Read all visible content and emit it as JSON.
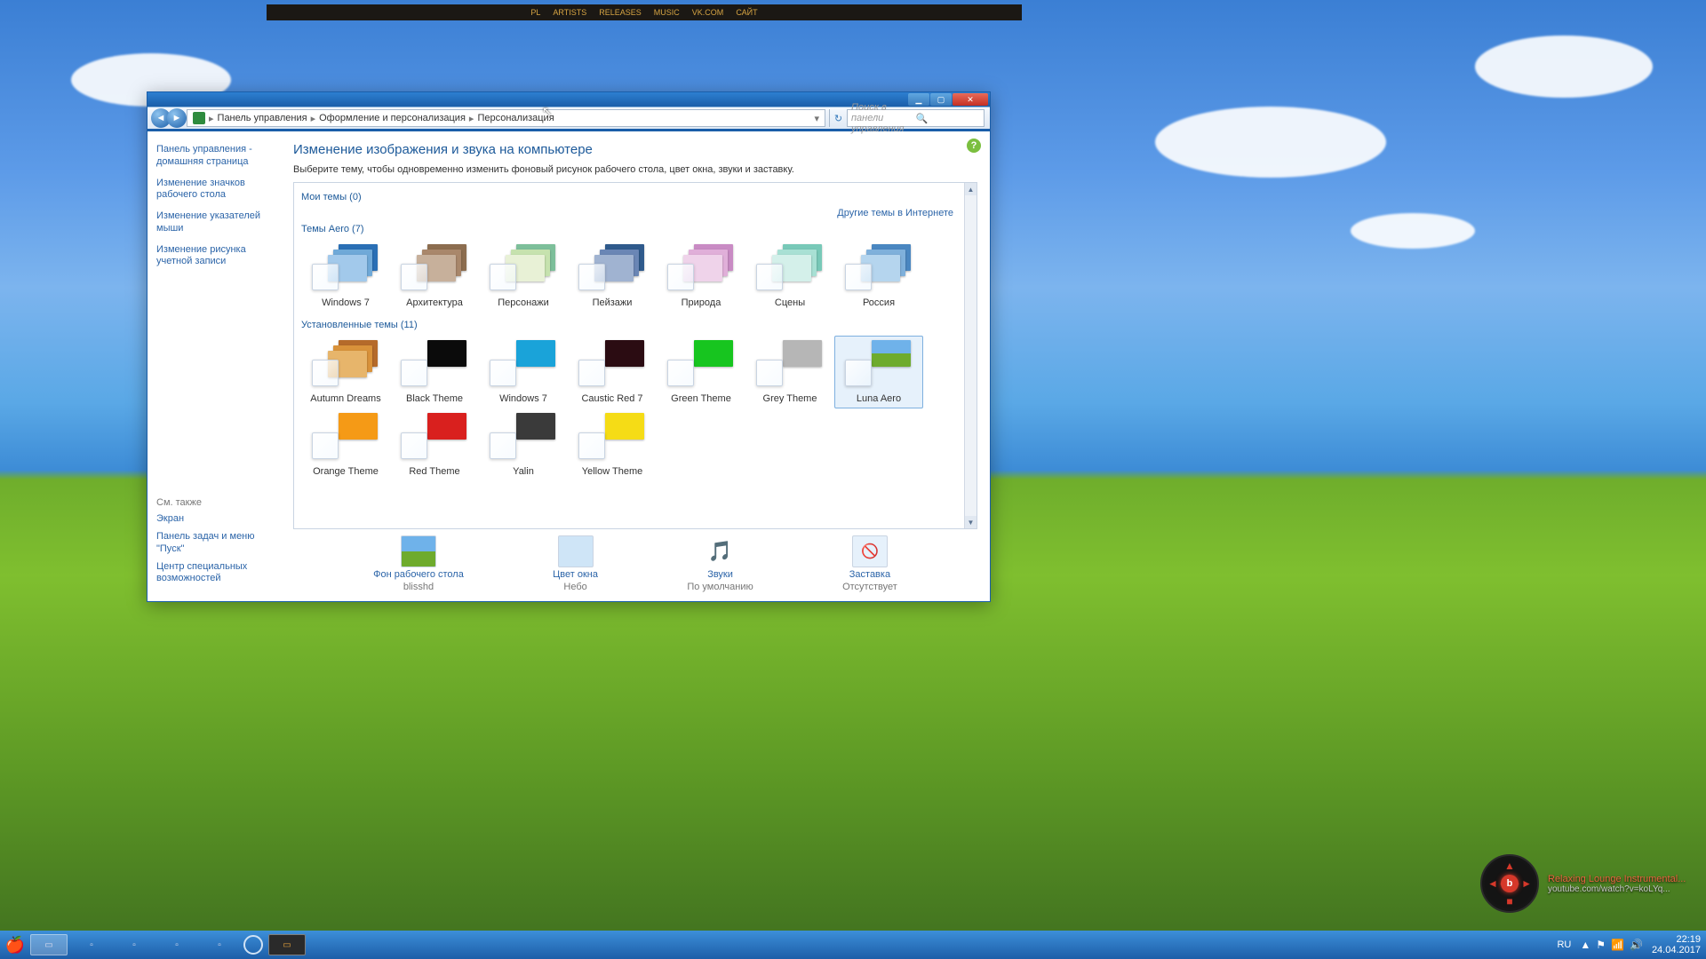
{
  "top_banner": {
    "items": [
      "PL",
      "ARTISTS",
      "RELEASES",
      "MUSIC",
      "VK.COM",
      "САЙТ"
    ]
  },
  "window": {
    "breadcrumb": [
      "Панель управления",
      "Оформление и персонализация",
      "Персонализация"
    ],
    "search_placeholder": "Поиск в панели управления",
    "sidebar": {
      "links": [
        "Панель управления - домашняя страница",
        "Изменение значков рабочего стола",
        "Изменение указателей мыши",
        "Изменение рисунка учетной записи"
      ],
      "see_also_header": "См. также",
      "see_also": [
        "Экран",
        "Панель задач и меню \"Пуск\"",
        "Центр специальных возможностей"
      ]
    },
    "main": {
      "heading": "Изменение изображения и звука на компьютере",
      "sub": "Выберите тему, чтобы одновременно изменить фоновый рисунок рабочего стола, цвет окна, звуки и заставку.",
      "my_themes_label": "Мои темы (0)",
      "online_link": "Другие темы в Интернете",
      "aero_label": "Темы Aero (7)",
      "aero": [
        {
          "name": "Windows 7",
          "c1": "#2a6fb5",
          "c2": "#6fa9d8",
          "c3": "#a2c9eb"
        },
        {
          "name": "Архитектура",
          "c1": "#8c6d4f",
          "c2": "#a9876b",
          "c3": "#c7b09b"
        },
        {
          "name": "Персонажи",
          "c1": "#7dbf9a",
          "c2": "#c6e2ae",
          "c3": "#e8f1d6"
        },
        {
          "name": "Пейзажи",
          "c1": "#2f5a8c",
          "c2": "#6a86b5",
          "c3": "#a0b3d1"
        },
        {
          "name": "Природа",
          "c1": "#c98bc4",
          "c2": "#e0afd9",
          "c3": "#efd3ea"
        },
        {
          "name": "Сцены",
          "c1": "#78c9b8",
          "c2": "#a8e0d4",
          "c3": "#d4f0ea"
        },
        {
          "name": "Россия",
          "c1": "#4a87c1",
          "c2": "#7fb0db",
          "c3": "#b5d5ee"
        }
      ],
      "installed_label": "Установленные темы (11)",
      "installed": [
        {
          "name": "Autumn Dreams",
          "c": "#b56a2a"
        },
        {
          "name": "Black Theme",
          "c": "#0b0b0b"
        },
        {
          "name": "Windows 7",
          "c": "#1aa3d9"
        },
        {
          "name": "Caustic Red 7",
          "c": "#2b0c12"
        },
        {
          "name": "Green Theme",
          "c": "#17c51f"
        },
        {
          "name": "Grey Theme",
          "c": "#b6b6b6"
        },
        {
          "name": "Luna Aero",
          "c": "#5aa0e0",
          "selected": true
        },
        {
          "name": "Orange Theme",
          "c": "#f59a16"
        },
        {
          "name": "Red Theme",
          "c": "#d9201e"
        },
        {
          "name": "Yalin",
          "c": "#3a3a3a"
        },
        {
          "name": "Yellow Theme",
          "c": "#f5dc16"
        }
      ],
      "bottom": {
        "bg": {
          "title": "Фон рабочего стола",
          "val": "blisshd"
        },
        "color": {
          "title": "Цвет окна",
          "val": "Небо"
        },
        "sounds": {
          "title": "Звуки",
          "val": "По умолчанию"
        },
        "saver": {
          "title": "Заставка",
          "val": "Отсутствует"
        }
      }
    }
  },
  "music": {
    "title": "Relaxing Lounge Instrumental...",
    "src": "youtube.com/watch?v=koLYq..."
  },
  "taskbar": {
    "lang": "RU",
    "time": "22:19",
    "date": "24.04.2017"
  }
}
